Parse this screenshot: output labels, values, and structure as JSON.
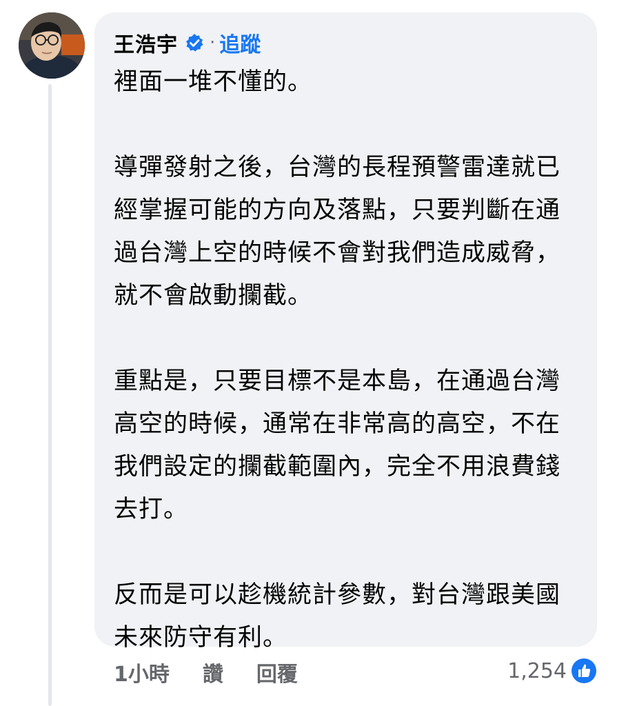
{
  "comment": {
    "author": "王浩宇",
    "separator": "·",
    "follow_label": "追蹤",
    "paragraphs": [
      "裡面一堆不懂的。",
      "導彈發射之後，台灣的長程預警雷達就已經掌握可能的方向及落點，只要判斷在通過台灣上空的時候不會對我們造成威脅，就不會啟動攔截。",
      "重點是，只要目標不是本島，在通過台灣高空的時候，通常在非常高的高空，不在我們設定的攔截範圍內，完全不用浪費錢去打。",
      "反而是可以趁機統計參數，對台灣跟美國未來防守有利。"
    ],
    "timestamp": "1小時",
    "like_label": "讚",
    "reply_label": "回覆",
    "reaction_count": "1,254",
    "reaction_icon": "like-icon",
    "verified_icon": "verified-badge-icon"
  },
  "colors": {
    "bubble_bg": "#f0f2f5",
    "link_blue": "#1877f2",
    "meta_gray": "#65676b",
    "text": "#050505"
  }
}
